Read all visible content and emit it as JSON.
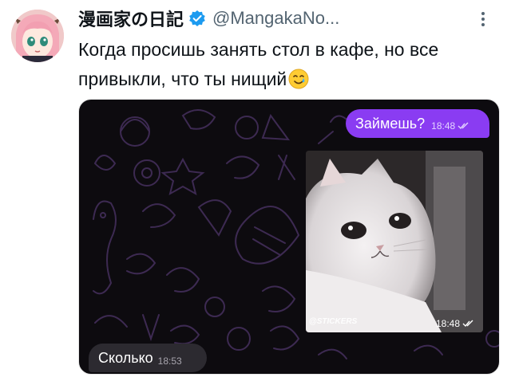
{
  "tweet": {
    "display_name": "漫画家の日記",
    "handle": "@MangakaNo...",
    "text": "Когда просишь занять стол в кафе, но все привыкли, что ты нищий",
    "emoji": "smiling-face-with-tear-icon",
    "verified_badge": "verified-badge-icon",
    "more_icon": "more-options-icon"
  },
  "chat": {
    "outgoing_message": "Займешь?",
    "outgoing_time": "18:48",
    "sticker_brand": "@STICKERS",
    "sticker_time": "18:48",
    "incoming_message": "Сколько",
    "incoming_time": "18:53",
    "colors": {
      "outgoing_bubble": "#8a3cf2",
      "incoming_bubble": "#2c2a30",
      "background": "#0d0b0f",
      "doodle": "#3d2a52"
    }
  }
}
